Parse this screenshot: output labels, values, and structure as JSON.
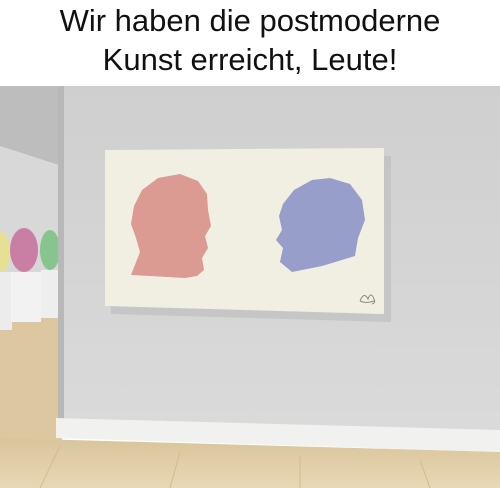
{
  "caption": {
    "line1": "Wir haben die postmoderne",
    "line2": "Kunst erreicht, Leute!"
  },
  "scene": {
    "wall_color": "#d3d3d3",
    "floor_color": "#e2cfa8",
    "baseboard_color": "#f1f1ef",
    "canvas_color": "#f1eee2",
    "left_head_color": "#d9918a",
    "right_head_color": "#8c95c6",
    "vase_colors": [
      "#e6e094",
      "#c97fa3",
      "#87c48e"
    ]
  }
}
